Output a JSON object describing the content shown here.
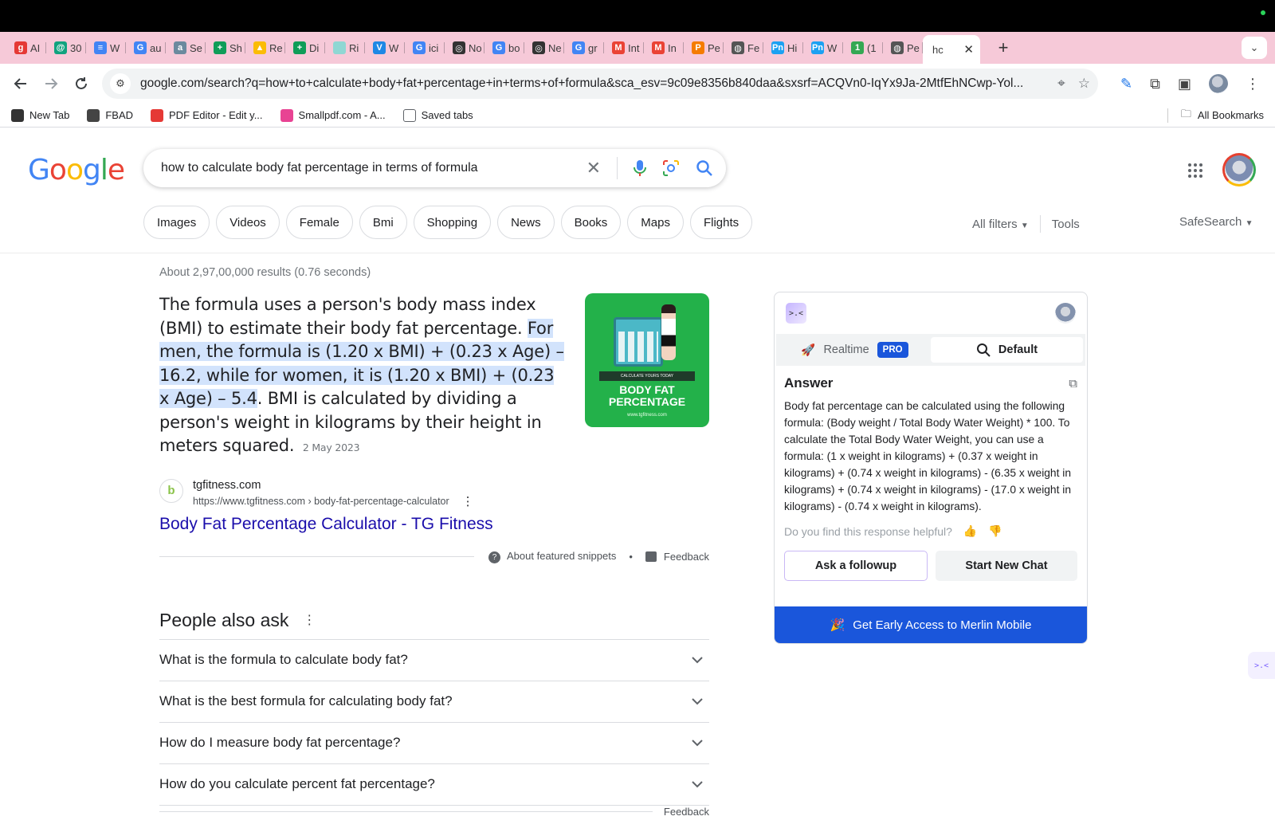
{
  "browser": {
    "tabs": [
      {
        "label": "AI",
        "icon": "g",
        "color": "#e53935"
      },
      {
        "label": "30",
        "icon": "@",
        "color": "#10a37f"
      },
      {
        "label": "W",
        "icon": "≡",
        "color": "#4285f4"
      },
      {
        "label": "au",
        "icon": "G",
        "color": "#4285f4"
      },
      {
        "label": "Se",
        "icon": "a",
        "color": "#6b8a9e"
      },
      {
        "label": "Sh",
        "icon": "+",
        "color": "#0f9d58"
      },
      {
        "label": "Re",
        "icon": "▲",
        "color": "#fbbc05"
      },
      {
        "label": "Di",
        "icon": "+",
        "color": "#0f9d58"
      },
      {
        "label": "Ri",
        "icon": "",
        "color": "#8fd7d3"
      },
      {
        "label": "W",
        "icon": "V",
        "color": "#1e88e5"
      },
      {
        "label": "ici",
        "icon": "G",
        "color": "#4285f4"
      },
      {
        "label": "No",
        "icon": "◎",
        "color": "#333333"
      },
      {
        "label": "bo",
        "icon": "G",
        "color": "#4285f4"
      },
      {
        "label": "Ne",
        "icon": "◎",
        "color": "#333333"
      },
      {
        "label": "gr",
        "icon": "G",
        "color": "#4285f4"
      },
      {
        "label": "Int",
        "icon": "M",
        "color": "#ea4335"
      },
      {
        "label": "In",
        "icon": "M",
        "color": "#ea4335"
      },
      {
        "label": "Pe",
        "icon": "P",
        "color": "#f57c00"
      },
      {
        "label": "Fe",
        "icon": "◍",
        "color": "#555555"
      },
      {
        "label": "Hi",
        "icon": "Pn",
        "color": "#1da1f2"
      },
      {
        "label": "W",
        "icon": "Pn",
        "color": "#1da1f2"
      },
      {
        "label": "(1",
        "icon": "1",
        "color": "#34a853"
      },
      {
        "label": "Pe",
        "icon": "◍",
        "color": "#555555"
      }
    ],
    "active_tab": {
      "label": "hc",
      "close": "✕"
    },
    "new_tab": "+",
    "tab_menu": "⌄",
    "url": "google.com/search?q=how+to+calculate+body+fat+percentage+in+terms+of+formula&sca_esv=9c09e8356b840daa&sxsrf=ACQVn0-IqYx9Ja-2MtfEhNCwp-Yol...",
    "bookmarks": [
      {
        "label": "New Tab",
        "color": "#333333"
      },
      {
        "label": "FBAD",
        "color": "#444444"
      },
      {
        "label": "PDF Editor - Edit y...",
        "color": "#e53935"
      },
      {
        "label": "Smallpdf.com - A...",
        "color": "#e84393"
      },
      {
        "label": "Saved tabs",
        "color": "#ffffff"
      }
    ],
    "all_bookmarks": "All Bookmarks"
  },
  "google": {
    "logo_letters": [
      {
        "ch": "G",
        "color": "#4285f4"
      },
      {
        "ch": "o",
        "color": "#ea4335"
      },
      {
        "ch": "o",
        "color": "#fbbc05"
      },
      {
        "ch": "g",
        "color": "#4285f4"
      },
      {
        "ch": "l",
        "color": "#34a853"
      },
      {
        "ch": "e",
        "color": "#ea4335"
      }
    ],
    "query": "how to calculate body fat percentage in terms of formula",
    "chips": [
      "Images",
      "Videos",
      "Female",
      "Bmi",
      "Shopping",
      "News",
      "Books",
      "Maps",
      "Flights"
    ],
    "all_filters": "All filters",
    "tools": "Tools",
    "safesearch": "SafeSearch"
  },
  "results": {
    "stats": "About 2,97,00,000 results (0.76 seconds)",
    "snippet_pre": "The formula uses a person's body mass index (BMI) to estimate their body fat percentage. ",
    "snippet_highlight": "For men, the formula is (1.20 x BMI) + (0.23 x Age) – 16.2, while for women, it is (1.20 x BMI) + (0.23 x Age) – 5.4",
    "snippet_post": ". BMI is calculated by dividing a person's weight in kilograms by their height in meters squared.",
    "snippet_date": "2 May 2023",
    "thumb": {
      "caption": "CALCULATE YOURS TODAY",
      "title_line1": "BODY FAT",
      "title_line2": "PERCENTAGE",
      "site": "www.tgfitness.com"
    },
    "source_name": "tgfitness.com",
    "source_url": "https://www.tgfitness.com › body-fat-percentage-calculator",
    "source_title": "Body Fat Percentage Calculator - TG Fitness",
    "about_snippets": "About featured snippets",
    "feedback": "Feedback",
    "paa_title": "People also ask",
    "paa": [
      "What is the formula to calculate body fat?",
      "What is the best formula for calculating body fat?",
      "How do I measure body fat percentage?",
      "How do you calculate percent fat percentage?"
    ],
    "paa_feedback": "Feedback"
  },
  "merlin": {
    "tab_realtime": "Realtime",
    "pro": "PRO",
    "tab_default": "Default",
    "answer_title": "Answer",
    "answer": "Body fat percentage can be calculated using the following formula: (Body weight / Total Body Water Weight) * 100. To calculate the Total Body Water Weight, you can use a formula: (1 x weight in kilograms) + (0.37 x weight in kilograms) + (0.74 x weight in kilograms) - (6.35 x weight in kilograms) + (0.74 x weight in kilograms) - (17.0 x weight in kilograms) - (0.74 x weight in kilograms).",
    "helpful": "Do you find this response helpful?",
    "followup": "Ask a followup",
    "new_chat": "Start New Chat",
    "cta": "Get Early Access to Merlin Mobile"
  }
}
